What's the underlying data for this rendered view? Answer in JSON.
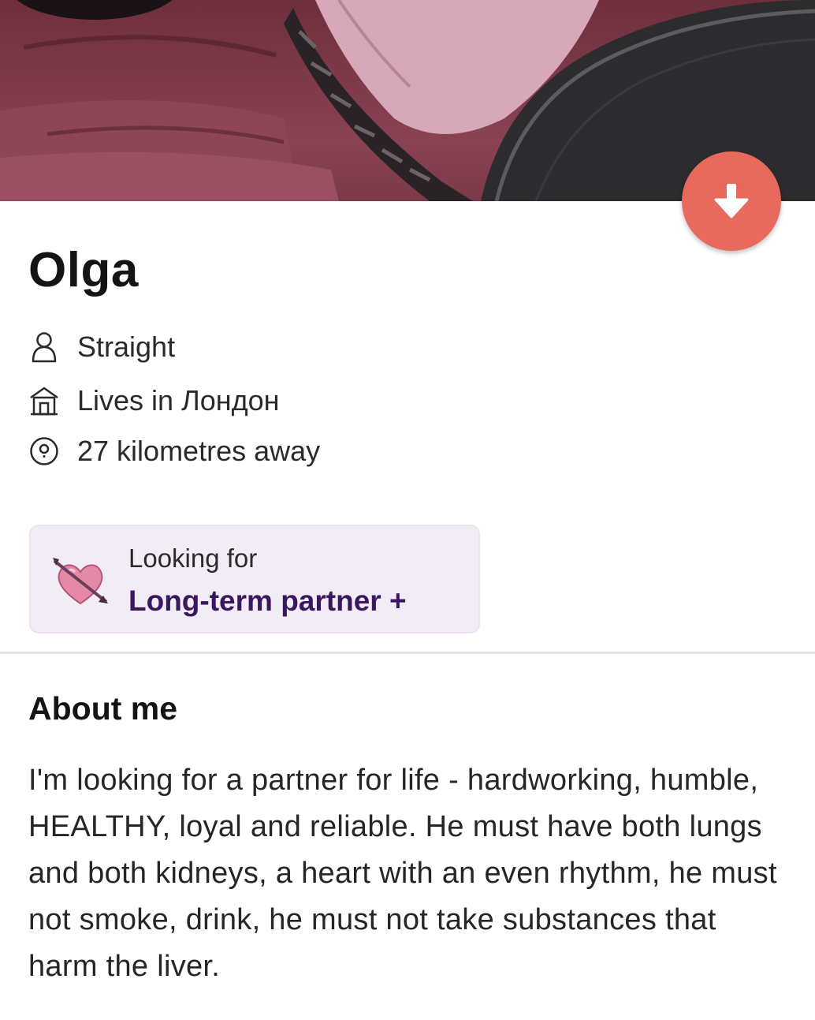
{
  "profile": {
    "name": "Olga",
    "orientation": "Straight",
    "lives_in": "Lives in Лондон",
    "distance": "27 kilometres away"
  },
  "looking_for": {
    "label": "Looking for",
    "value": "Long-term partner +"
  },
  "about": {
    "heading": "About me",
    "text": "I'm looking for a partner for life - hardworking, humble, HEALTHY, loyal and reliable. He must have both lungs and both kidneys, a heart with an even rhythm, he must not smoke, drink, he must not take substances that harm the liver."
  },
  "icons": {
    "orientation": "person-icon",
    "lives_in": "house-icon",
    "distance": "location-pin-icon",
    "looking_for": "heart-with-arrow-icon",
    "action": "arrow-down-icon"
  },
  "colors": {
    "action_button": "#e86a5c",
    "looking_for_card": "#f1ecf5",
    "looking_for_value": "#3b1760"
  }
}
